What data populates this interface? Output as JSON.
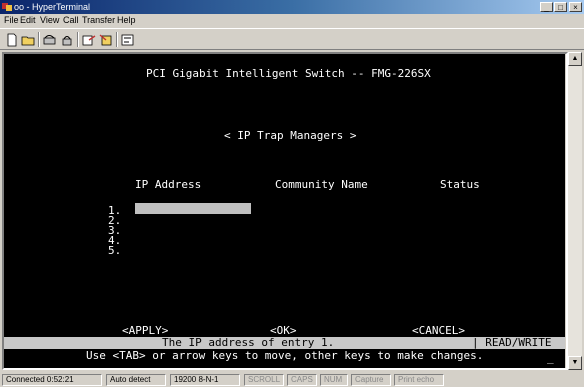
{
  "window": {
    "title": "oo - HyperTerminal",
    "min_glyph": "_",
    "max_glyph": "□",
    "close_glyph": "×"
  },
  "menu": [
    "File",
    "Edit",
    "View",
    "Call",
    "Transfer",
    "Help"
  ],
  "toolbar_icons": [
    "new-icon",
    "open-icon",
    "connect-icon",
    "disconnect-icon",
    "send-icon",
    "receive-icon",
    "properties-icon"
  ],
  "terminal": {
    "heading": "PCI Gigabit Intelligent Switch -- FMG-226SX",
    "screen_title": "< IP Trap Managers >",
    "columns": [
      "IP Address",
      "Community Name",
      "Status"
    ],
    "entries": [
      {
        "num": "1.",
        "ip": "",
        "community": "",
        "status": ""
      },
      {
        "num": "2.",
        "ip": "",
        "community": "",
        "status": ""
      },
      {
        "num": "3.",
        "ip": "",
        "community": "",
        "status": ""
      },
      {
        "num": "4.",
        "ip": "",
        "community": "",
        "status": ""
      },
      {
        "num": "5.",
        "ip": "",
        "community": "",
        "status": ""
      }
    ],
    "apply": "<APPLY>",
    "ok": "<OK>",
    "cancel": "<CANCEL>",
    "help_text": "The IP address of entry 1.",
    "mode": "| READ/WRITE",
    "instructions": "Use <TAB> or arrow keys to move, other keys to make changes.",
    "cursor": "_"
  },
  "statusbar": {
    "connected": "Connected 0:52:21",
    "detect": "Auto detect",
    "settings": "19200 8-N-1",
    "scroll": "SCROLL",
    "caps": "CAPS",
    "num": "NUM",
    "capture": "Capture",
    "print_echo": "Print echo"
  },
  "colors": {
    "terminal_bg": "#000000",
    "terminal_fg": "#ffffff",
    "input_bg": "#c0c0c0",
    "title_gradient_start": "#0a246a"
  }
}
